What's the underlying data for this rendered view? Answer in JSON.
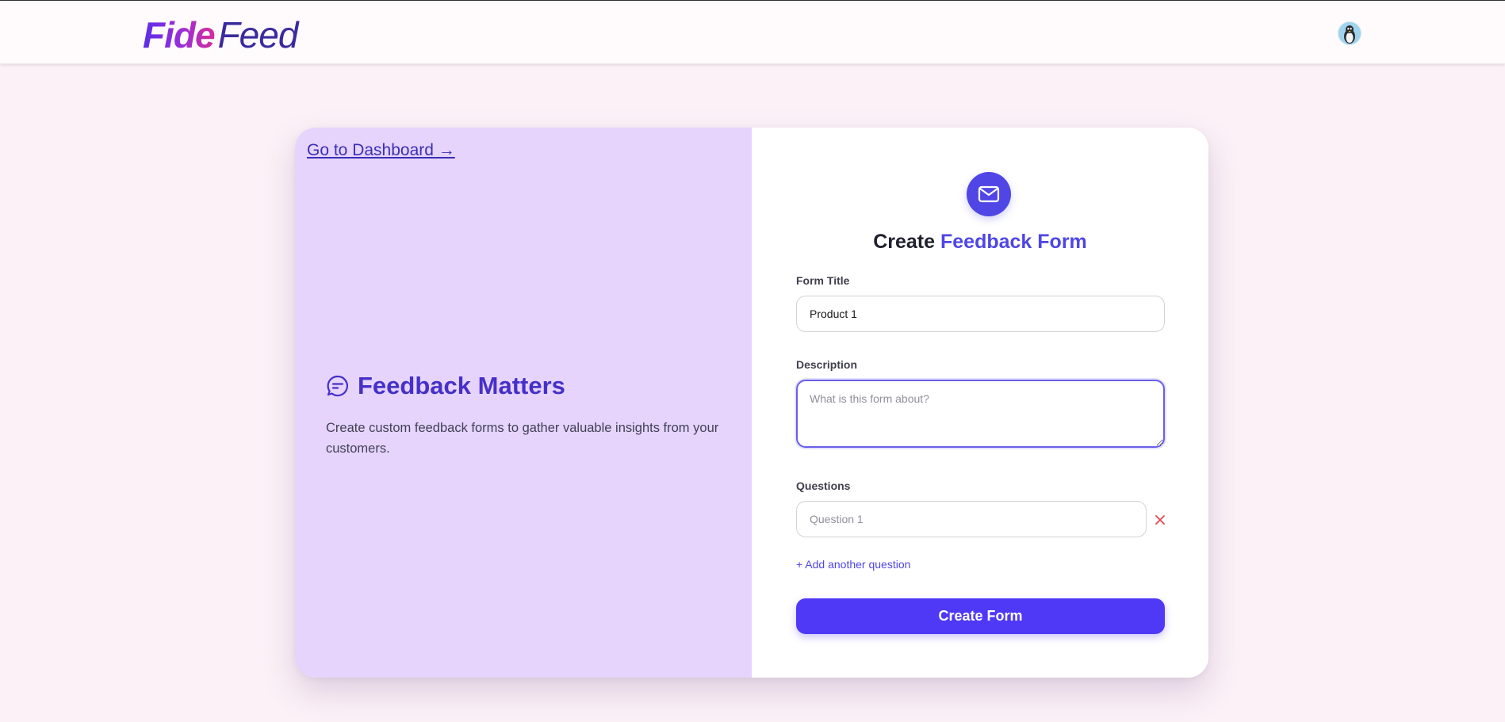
{
  "header": {
    "logo_part1": "Fide",
    "logo_part2": "Feed",
    "avatar_icon": "penguin-avatar-icon"
  },
  "left_panel": {
    "dashboard_link": "Go to Dashboard →",
    "promo_icon": "message-bubble-icon",
    "promo_title": "Feedback Matters",
    "promo_text": "Create custom feedback forms to gather valuable insights from your customers."
  },
  "form": {
    "badge_icon": "mail-icon",
    "heading_prefix": "Create",
    "heading_accent": "Feedback Form",
    "title_label": "Form Title",
    "title_value": "Product 1",
    "description_label": "Description",
    "description_placeholder": "What is this form about?",
    "description_value": "",
    "questions_label": "Questions",
    "question_placeholder": "Question 1",
    "question_value": "",
    "remove_icon": "close-icon",
    "add_question": "+ Add another question",
    "submit_label": "Create Form"
  },
  "colors": {
    "page_background": "#fcf1f7",
    "left_panel_background": "#e6d4fd",
    "accent": "#4f46e5",
    "button": "#4f39f6",
    "remove_icon": "#e5484d"
  }
}
